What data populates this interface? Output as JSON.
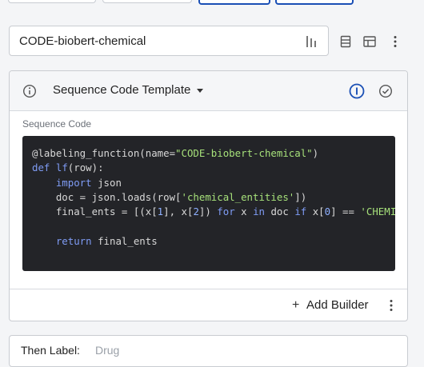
{
  "name_field": {
    "value": "CODE-biobert-chemical"
  },
  "template": {
    "title": "Sequence Code Template",
    "label": "Sequence Code",
    "code_lines": [
      [
        {
          "t": "@labeling_function(name="
        },
        {
          "t": "\"CODE-biobert-chemical\"",
          "c": "str"
        },
        {
          "t": ")"
        }
      ],
      [
        {
          "t": "def",
          "c": "kw"
        },
        {
          "t": " "
        },
        {
          "t": "lf",
          "c": "kw"
        },
        {
          "t": "(row):"
        }
      ],
      [
        {
          "t": "    "
        },
        {
          "t": "import",
          "c": "kw"
        },
        {
          "t": " json"
        }
      ],
      [
        {
          "t": "    doc = json.loads(row["
        },
        {
          "t": "'chemical_entities'",
          "c": "str"
        },
        {
          "t": "])"
        }
      ],
      [
        {
          "t": "    final_ents = [(x["
        },
        {
          "t": "1",
          "c": "num"
        },
        {
          "t": "], x["
        },
        {
          "t": "2",
          "c": "num"
        },
        {
          "t": "]) "
        },
        {
          "t": "for",
          "c": "kw"
        },
        {
          "t": " x "
        },
        {
          "t": "in",
          "c": "kw"
        },
        {
          "t": " doc "
        },
        {
          "t": "if",
          "c": "kw"
        },
        {
          "t": " x["
        },
        {
          "t": "0",
          "c": "num"
        },
        {
          "t": "] == "
        },
        {
          "t": "'CHEMICAL'",
          "c": "str"
        }
      ],
      [
        {
          "t": ""
        }
      ],
      [
        {
          "t": "    "
        },
        {
          "t": "return",
          "c": "kw"
        },
        {
          "t": " final_ents"
        }
      ]
    ]
  },
  "footer": {
    "add_builder": "Add Builder",
    "plus": "+"
  },
  "then": {
    "label": "Then Label:",
    "value": "Drug"
  },
  "colors": {
    "accent": "#1a4fb5",
    "code_bg": "#232428"
  }
}
